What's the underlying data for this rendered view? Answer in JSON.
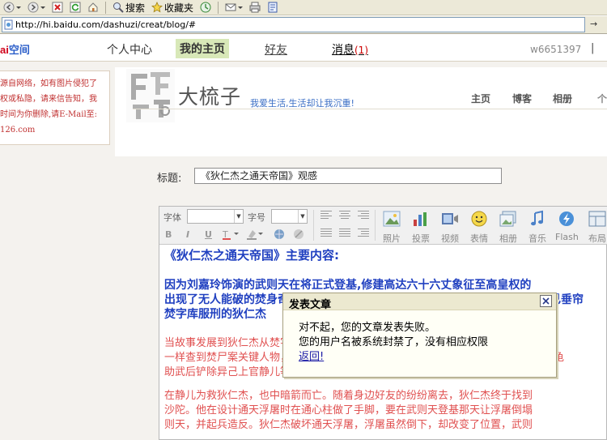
{
  "browser": {
    "toolbar": {
      "search_label": "搜索",
      "favorites_label": "收藏夹"
    },
    "address": {
      "url": "http://hi.baidu.com/dashuzi/creat/blog/#"
    }
  },
  "site": {
    "logo": {
      "part1": "ai",
      "part2": "空间"
    },
    "nav": {
      "center": "个人中心",
      "home": "我的主页",
      "friends": "好友",
      "messages": "消息",
      "messages_count": "(1)"
    },
    "username": "w6651397",
    "user_more": "|"
  },
  "sidebar_note": {
    "lines": [
      "源自网络，如有图片侵犯了",
      "权或私隐，请来信告知，我",
      "时间为你删除,请E-Mail至:",
      "126.com"
    ]
  },
  "blog": {
    "name": "大梳子",
    "slogan": "我爱生活,生活却让我沉重!",
    "tabs": {
      "home": "主页",
      "blog": "博客",
      "album": "相册",
      "more": "个"
    }
  },
  "editor_form": {
    "title_label": "标题:",
    "title_value": "《狄仁杰之通天帝国》观感"
  },
  "editor": {
    "toolbar": {
      "font_label": "字体",
      "size_label": "字号",
      "bold": "B",
      "italic": "I",
      "underline": "U",
      "buttons": [
        "照片",
        "投票",
        "视频",
        "表情",
        "相册",
        "音乐",
        "Flash",
        "布局"
      ]
    },
    "content": {
      "heading": "《狄仁杰之通天帝国》主要内容:",
      "bold_lines": [
        "因为刘嘉玲饰演的武则天在将正式登基,修建高达六十六丈象征至高皇权的",
        "出现了无人能破的焚身奇案。在众臣纷纷中招，人心惶惶之时，武则天为保自己垂帘",
        "焚字库服刑的狄仁杰"
      ],
      "red_lines_1": [
        "当故事发展到狄仁杰从焚字库中放出来时，狄仁杰的周边好友都有危险而死，情况",
        "一样查到焚尸案关键人物，通过实验发现了焚身真相的秘密。原来，是一种叫赤焰金龟",
        "助武后铲除异己上官静儿等暗设陷阱刚烈王。"
      ],
      "red_lines_2": [
        "在静儿为救狄仁杰，也中暗箭而亡。随着身边好友的纷纷离去，狄仁杰终于找到",
        "沙陀。他在设计通天浮屠时在通心柱做了手脚，要在武则天登基那天让浮屠倒塌",
        "则天，并起兵造反。狄仁杰破坏通天浮屠，浮屠虽然倒下，却改变了位置，武则"
      ]
    }
  },
  "dialog": {
    "title": "发表文章",
    "line1": "对不起，您的文章发表失败。",
    "line2": "您的用户名被系统封禁了，没有相应权限",
    "link": "返回!"
  }
}
